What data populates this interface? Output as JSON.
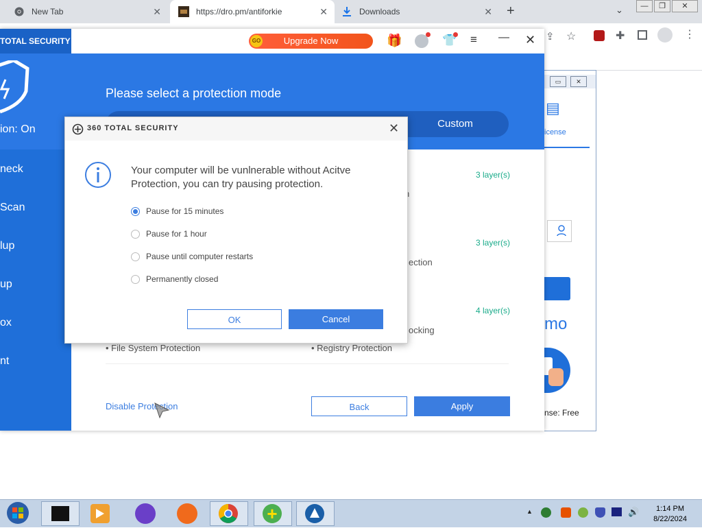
{
  "browser": {
    "tabs": [
      {
        "label": "New Tab",
        "icon": "chrome-icon"
      },
      {
        "label": "https://dro.pm/antiforkie",
        "icon": "site-favicon"
      },
      {
        "label": "Downloads",
        "icon": "download-icon"
      }
    ],
    "new_tab": "+",
    "controls": {
      "minimize": "—",
      "restore": "❐",
      "close": "✕"
    }
  },
  "app": {
    "brand": "TOTAL SECURITY",
    "upgrade_label": "Upgrade Now",
    "upgrade_badge": "GO",
    "protection_status": "ion: On",
    "sidebar_items": [
      "neck",
      "Scan",
      "lup",
      "up",
      "ox",
      "nt"
    ],
    "mode_title": "Please select a protection mode",
    "mode_custom": "Custom",
    "layers": [
      "3 layer(s)",
      "3 layer(s)",
      "4 layer(s)"
    ],
    "partial_text": [
      "ection",
      "ocking"
    ],
    "features": [
      "File System Protection",
      "Registry Protection"
    ],
    "disable_link": "Disable Protection",
    "back_label": "Back",
    "apply_label": "Apply",
    "accent": "#2b78e4"
  },
  "background_window": {
    "license_tab": "icense",
    "promo": "mo",
    "license_text": "nse: Free"
  },
  "dialog": {
    "brand": "360 TOTAL SECURITY",
    "message": "Your computer will be vunlnerable without Acitve Protection, you can try pausing protection.",
    "options": [
      {
        "label": "Pause for 15 minutes",
        "selected": true
      },
      {
        "label": "Pause for 1 hour",
        "selected": false
      },
      {
        "label": "Pause until computer restarts",
        "selected": false
      },
      {
        "label": "Permanently closed",
        "selected": false
      }
    ],
    "ok_label": "OK",
    "cancel_label": "Cancel"
  },
  "taskbar": {
    "time": "1:14 PM",
    "date": "8/22/2024"
  }
}
